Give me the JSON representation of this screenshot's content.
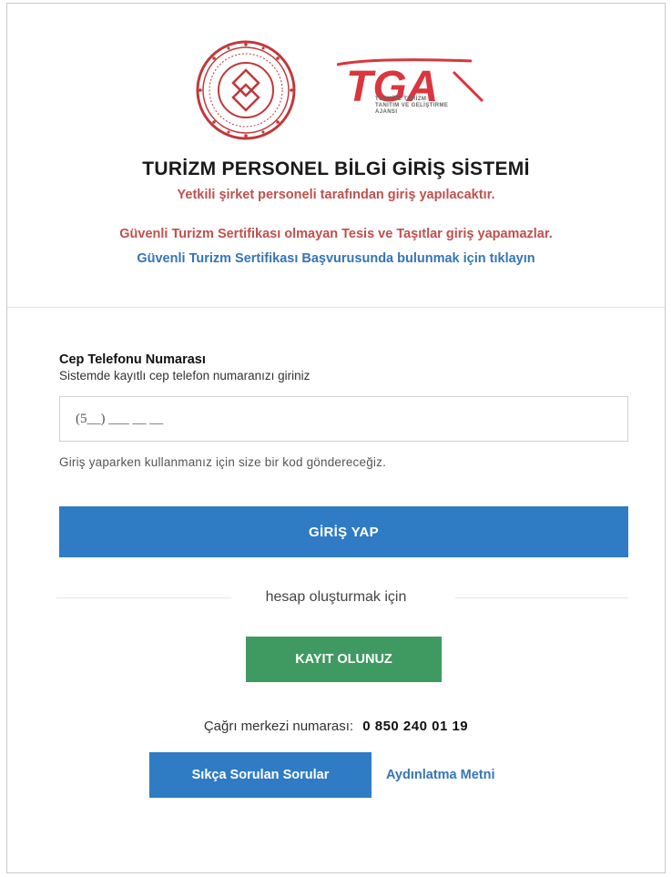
{
  "header": {
    "tga_logo_text": "TGA",
    "tga_logo_subtext_1": "TÜRKİYE TURİZM",
    "tga_logo_subtext_2": "TANITIM VE GELİŞTİRME",
    "tga_logo_subtext_3": "AJANSI",
    "title": "TURİZM PERSONEL BİLGİ GİRİŞ SİSTEMİ",
    "subtitle": "Yetkili şirket personeli tarafından giriş yapılacaktır.",
    "warning": "Güvenli Turizm Sertifikası olmayan Tesis ve Taşıtlar giriş yapamazlar.",
    "apply_link": "Güvenli Turizm Sertifikası Başvurusunda bulunmak için tıklayın"
  },
  "form": {
    "phone_label": "Cep Telefonu Numarası",
    "phone_help": "Sistemde kayıtlı cep telefon numaranızı giriniz",
    "phone_placeholder": "(5__) ___ __ __",
    "code_note": "Giriş yaparken kullanmanız için size bir kod göndereceğiz.",
    "login_button": "GİRİŞ YAP",
    "or_text": "hesap oluşturmak için",
    "register_button": "KAYIT OLUNUZ"
  },
  "footer": {
    "call_center_label": "Çağrı merkezi numarası:",
    "call_center_number": "0 850 240 01 19",
    "faq_button": "Sıkça Sorulan Sorular",
    "privacy_link": "Aydınlatma Metni"
  },
  "colors": {
    "primary_blue": "#2f7bc4",
    "register_green": "#3f9a61",
    "warning_red": "#c0504d",
    "link_blue": "#3574b8"
  },
  "icons": {
    "ministry_seal": "ministry-seal-icon",
    "tga_logo": "tga-logo-icon"
  }
}
